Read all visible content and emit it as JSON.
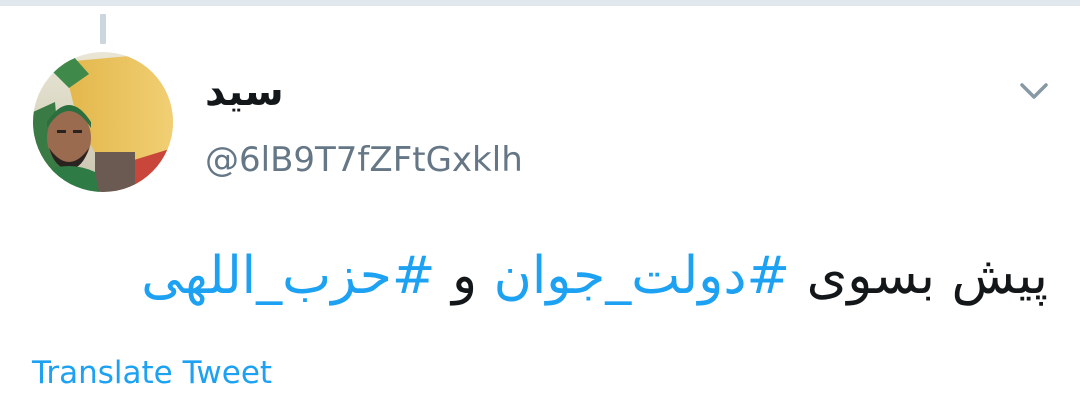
{
  "tweet": {
    "display_name": "سید",
    "handle": "@6lB9T7fZFtGxklh",
    "text_parts": [
      {
        "text": "پیش بسوی ",
        "type": "plain"
      },
      {
        "text": "#دولت_جوان",
        "type": "hashtag"
      },
      {
        "text": " و ",
        "type": "plain"
      },
      {
        "text": "#حزب_اللهی",
        "type": "hashtag"
      }
    ],
    "translate_label": "Translate Tweet"
  },
  "icons": {
    "menu": "chevron-down-icon",
    "avatar": "avatar"
  },
  "colors": {
    "link": "#1da1f2",
    "text": "#14171a",
    "secondary": "#657786",
    "divider": "#e1e8ed"
  }
}
